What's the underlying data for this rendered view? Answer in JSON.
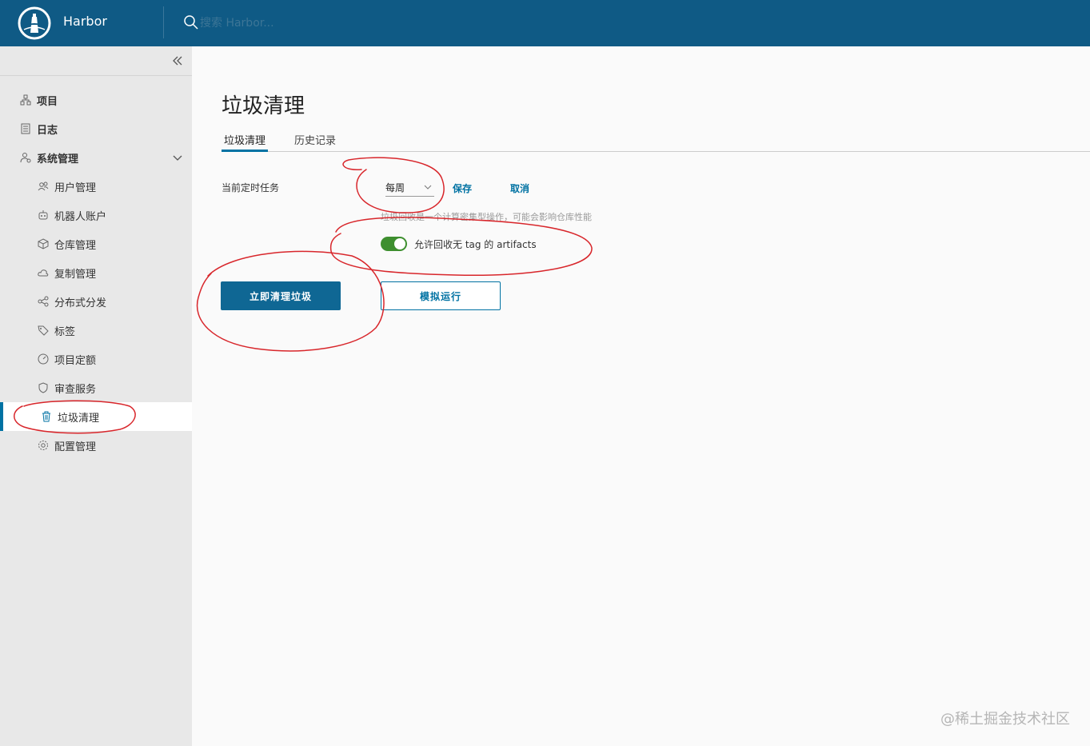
{
  "header": {
    "brand": "Harbor",
    "search_placeholder": "搜索 Harbor..."
  },
  "sidebar": {
    "items": [
      {
        "label": "项目",
        "icon": "project-icon"
      },
      {
        "label": "日志",
        "icon": "log-icon"
      },
      {
        "label": "系统管理",
        "icon": "admin-icon",
        "expanded": true
      },
      {
        "label": "用户管理",
        "icon": "users-icon"
      },
      {
        "label": "机器人账户",
        "icon": "robot-icon"
      },
      {
        "label": "仓库管理",
        "icon": "box-icon"
      },
      {
        "label": "复制管理",
        "icon": "cloud-icon"
      },
      {
        "label": "分布式分发",
        "icon": "share-icon"
      },
      {
        "label": "标签",
        "icon": "tag-icon"
      },
      {
        "label": "项目定额",
        "icon": "dashboard-icon"
      },
      {
        "label": "审查服务",
        "icon": "shield-icon"
      },
      {
        "label": "垃圾清理",
        "icon": "trash-icon",
        "active": true
      },
      {
        "label": "配置管理",
        "icon": "gear-icon"
      }
    ]
  },
  "main": {
    "title": "垃圾清理",
    "tabs": [
      {
        "label": "垃圾清理",
        "active": true
      },
      {
        "label": "历史记录",
        "active": false
      }
    ],
    "schedule_label": "当前定时任务",
    "schedule_value": "每周",
    "save_label": "保存",
    "cancel_label": "取消",
    "help_text": "垃圾回收是一个计算密集型操作，可能会影响仓库性能",
    "toggle_label": "允许回收无 tag 的 artifacts",
    "toggle_on": true,
    "gc_now_label": "立即清理垃圾",
    "dry_run_label": "模拟运行"
  },
  "watermark": "@稀土掘金技术社区",
  "colors": {
    "header": "#0f5a85",
    "accent": "#0072a3",
    "primary_button": "#0f6794",
    "toggle_on": "#3e8f2f",
    "annotation": "#d8262b"
  }
}
